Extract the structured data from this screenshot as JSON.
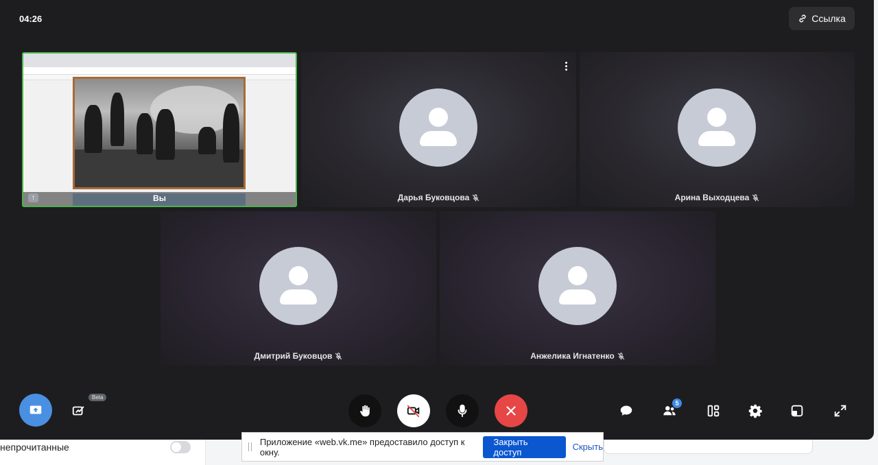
{
  "call": {
    "timer": "04:26",
    "link_label": "Ссылка"
  },
  "participants": {
    "self_name": "Вы",
    "tiles": [
      {
        "name": "Дарья Буковцова"
      },
      {
        "name": "Арина Выходцева"
      },
      {
        "name": "Дмитрий Буковцов"
      },
      {
        "name": "Анжелика Игнатенко"
      }
    ]
  },
  "controls": {
    "beta_label": "Beta",
    "participants_count": "5"
  },
  "background_page": {
    "unread_label": "непрочитанные"
  },
  "share_notification": {
    "text": "Приложение «web.vk.me» предоставило доступ к окну.",
    "stop_label": "Закрыть доступ",
    "hide_label": "Скрыть"
  },
  "colors": {
    "self_border": "#4bb34b",
    "share_button": "#4a90e2",
    "end_call": "#e64646",
    "stop_button": "#0b57d0"
  },
  "icons": [
    "link-icon",
    "kebab-menu-icon",
    "mic-off-icon",
    "screen-share-icon",
    "draw-icon",
    "raise-hand-icon",
    "camera-off-icon",
    "mic-icon",
    "end-call-icon",
    "chat-icon",
    "participants-icon",
    "layout-icon",
    "settings-icon",
    "pip-icon",
    "fullscreen-icon"
  ]
}
